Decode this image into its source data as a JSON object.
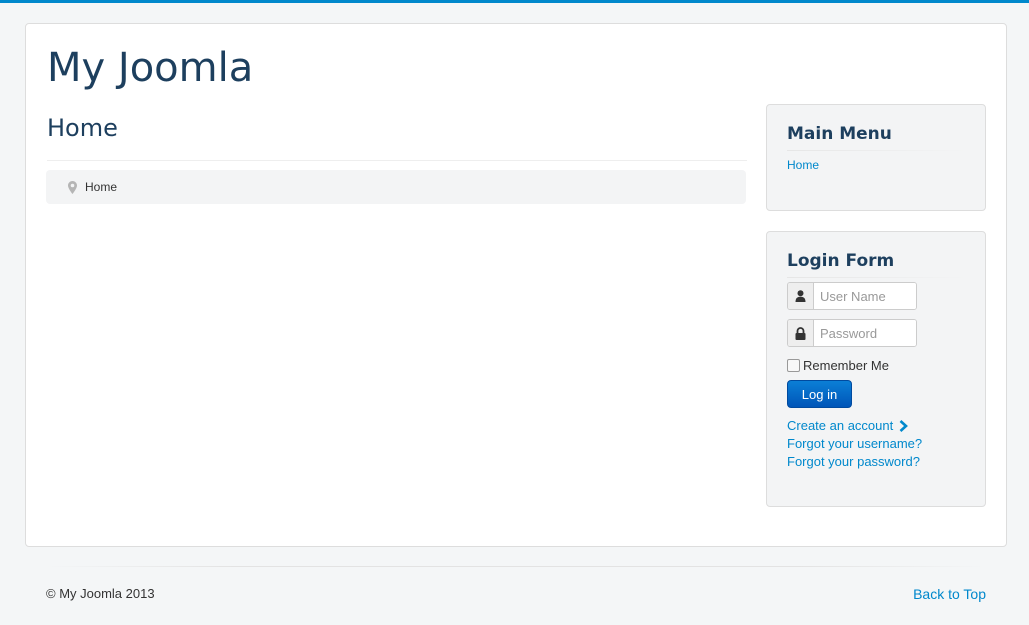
{
  "site": {
    "brand": "My Joomla"
  },
  "page": {
    "heading": "Home"
  },
  "breadcrumb": {
    "icon": "map-marker-icon",
    "items": [
      "Home"
    ]
  },
  "main_menu": {
    "title": "Main Menu",
    "items": [
      "Home"
    ]
  },
  "login_form": {
    "title": "Login Form",
    "username_placeholder": "User Name",
    "password_placeholder": "Password",
    "remember_label": "Remember Me",
    "submit_label": "Log in",
    "create_account": "Create an account",
    "forgot_username": "Forgot your username?",
    "forgot_password": "Forgot your password?"
  },
  "footer": {
    "copyright": "© My Joomla 2013",
    "back_to_top": "Back to Top"
  },
  "colors": {
    "accent": "#0088cc",
    "heading": "#1d3f5e",
    "button": "#0b6fd0"
  }
}
